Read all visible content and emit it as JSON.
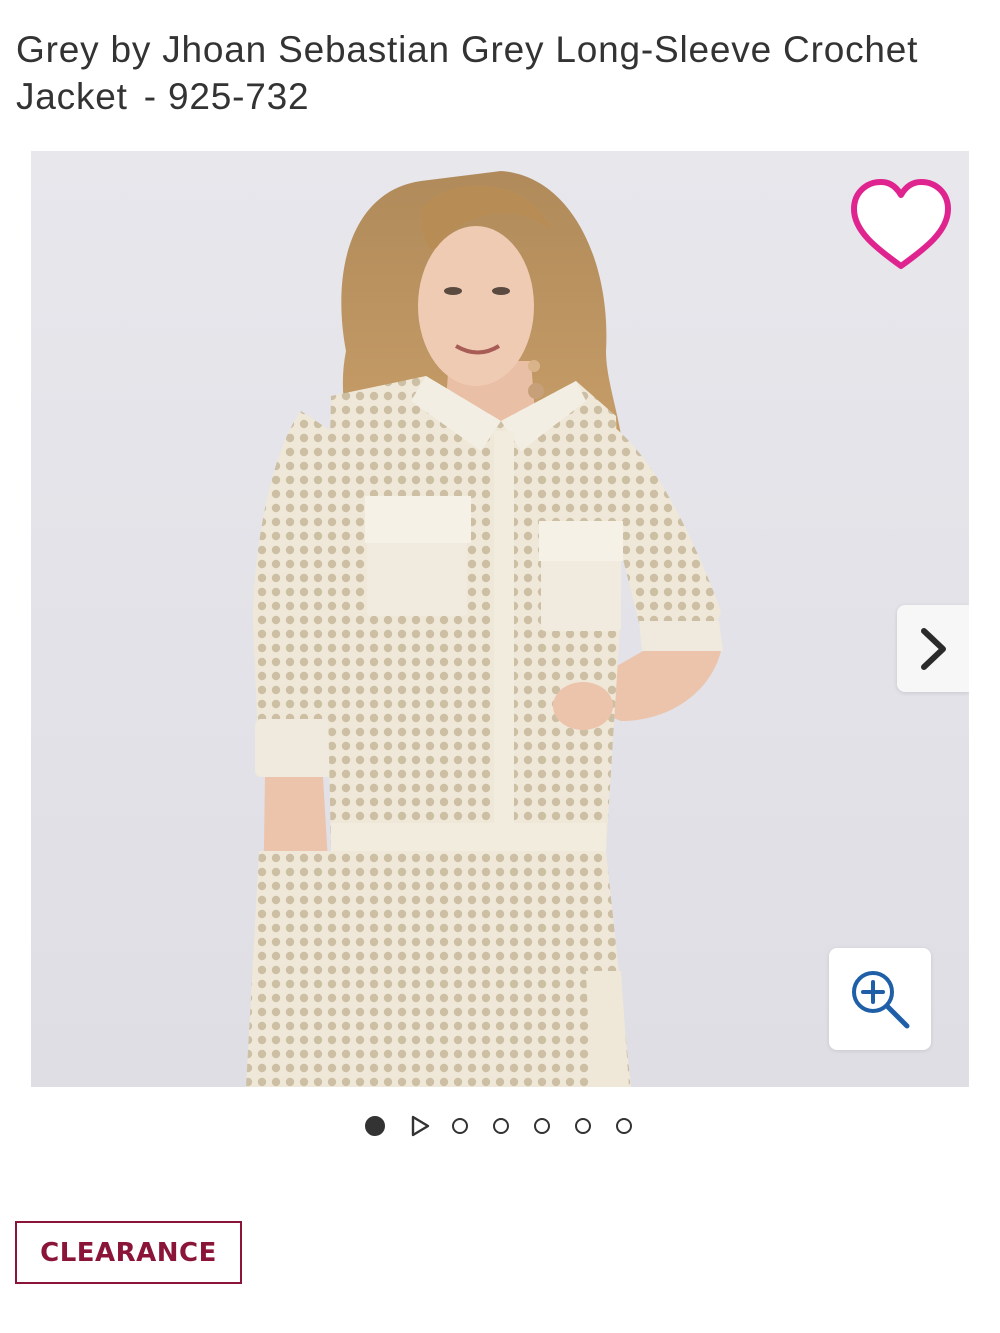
{
  "product": {
    "title": "Grey by Jhoan Sebastian Grey Long-Sleeve Crochet Jacket",
    "item_number": "- 925-732"
  },
  "gallery": {
    "photo_alt": "Woman wearing cream crochet long-sleeve jacket with matching pants",
    "slide_count": 7,
    "active_slide": 1,
    "has_video": true
  },
  "badge": {
    "label": "CLEARANCE"
  },
  "colors": {
    "heart": "#e0248f",
    "clearance": "#8a1538",
    "zoom": "#1f5fa8",
    "dot": "#333333"
  },
  "icons": {
    "favorite": "heart-outline-icon",
    "next": "chevron-right-icon",
    "zoom": "zoom-in-icon",
    "video": "play-icon"
  }
}
